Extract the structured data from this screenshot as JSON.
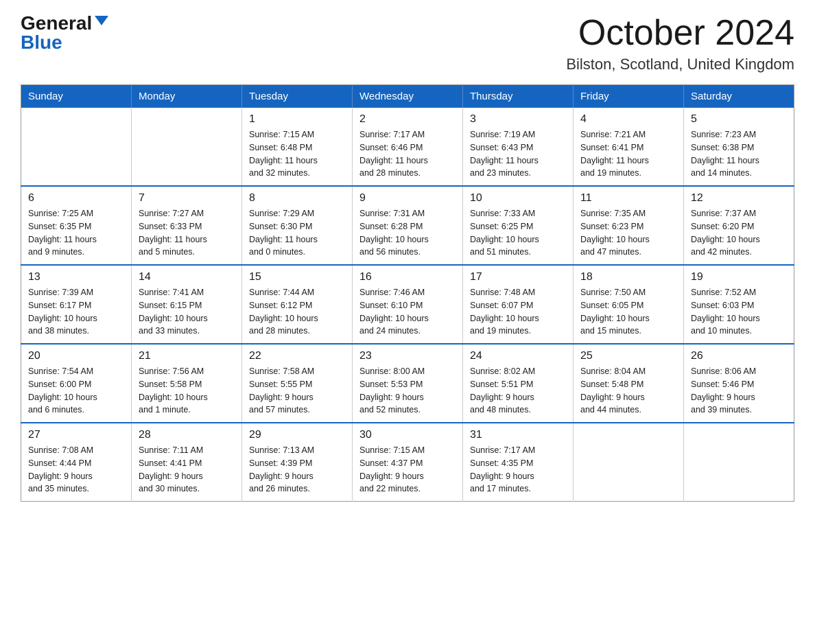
{
  "header": {
    "logo_general": "General",
    "logo_blue": "Blue",
    "month_title": "October 2024",
    "location": "Bilston, Scotland, United Kingdom"
  },
  "days_of_week": [
    "Sunday",
    "Monday",
    "Tuesday",
    "Wednesday",
    "Thursday",
    "Friday",
    "Saturday"
  ],
  "weeks": [
    [
      {
        "day": "",
        "info": ""
      },
      {
        "day": "",
        "info": ""
      },
      {
        "day": "1",
        "info": "Sunrise: 7:15 AM\nSunset: 6:48 PM\nDaylight: 11 hours\nand 32 minutes."
      },
      {
        "day": "2",
        "info": "Sunrise: 7:17 AM\nSunset: 6:46 PM\nDaylight: 11 hours\nand 28 minutes."
      },
      {
        "day": "3",
        "info": "Sunrise: 7:19 AM\nSunset: 6:43 PM\nDaylight: 11 hours\nand 23 minutes."
      },
      {
        "day": "4",
        "info": "Sunrise: 7:21 AM\nSunset: 6:41 PM\nDaylight: 11 hours\nand 19 minutes."
      },
      {
        "day": "5",
        "info": "Sunrise: 7:23 AM\nSunset: 6:38 PM\nDaylight: 11 hours\nand 14 minutes."
      }
    ],
    [
      {
        "day": "6",
        "info": "Sunrise: 7:25 AM\nSunset: 6:35 PM\nDaylight: 11 hours\nand 9 minutes."
      },
      {
        "day": "7",
        "info": "Sunrise: 7:27 AM\nSunset: 6:33 PM\nDaylight: 11 hours\nand 5 minutes."
      },
      {
        "day": "8",
        "info": "Sunrise: 7:29 AM\nSunset: 6:30 PM\nDaylight: 11 hours\nand 0 minutes."
      },
      {
        "day": "9",
        "info": "Sunrise: 7:31 AM\nSunset: 6:28 PM\nDaylight: 10 hours\nand 56 minutes."
      },
      {
        "day": "10",
        "info": "Sunrise: 7:33 AM\nSunset: 6:25 PM\nDaylight: 10 hours\nand 51 minutes."
      },
      {
        "day": "11",
        "info": "Sunrise: 7:35 AM\nSunset: 6:23 PM\nDaylight: 10 hours\nand 47 minutes."
      },
      {
        "day": "12",
        "info": "Sunrise: 7:37 AM\nSunset: 6:20 PM\nDaylight: 10 hours\nand 42 minutes."
      }
    ],
    [
      {
        "day": "13",
        "info": "Sunrise: 7:39 AM\nSunset: 6:17 PM\nDaylight: 10 hours\nand 38 minutes."
      },
      {
        "day": "14",
        "info": "Sunrise: 7:41 AM\nSunset: 6:15 PM\nDaylight: 10 hours\nand 33 minutes."
      },
      {
        "day": "15",
        "info": "Sunrise: 7:44 AM\nSunset: 6:12 PM\nDaylight: 10 hours\nand 28 minutes."
      },
      {
        "day": "16",
        "info": "Sunrise: 7:46 AM\nSunset: 6:10 PM\nDaylight: 10 hours\nand 24 minutes."
      },
      {
        "day": "17",
        "info": "Sunrise: 7:48 AM\nSunset: 6:07 PM\nDaylight: 10 hours\nand 19 minutes."
      },
      {
        "day": "18",
        "info": "Sunrise: 7:50 AM\nSunset: 6:05 PM\nDaylight: 10 hours\nand 15 minutes."
      },
      {
        "day": "19",
        "info": "Sunrise: 7:52 AM\nSunset: 6:03 PM\nDaylight: 10 hours\nand 10 minutes."
      }
    ],
    [
      {
        "day": "20",
        "info": "Sunrise: 7:54 AM\nSunset: 6:00 PM\nDaylight: 10 hours\nand 6 minutes."
      },
      {
        "day": "21",
        "info": "Sunrise: 7:56 AM\nSunset: 5:58 PM\nDaylight: 10 hours\nand 1 minute."
      },
      {
        "day": "22",
        "info": "Sunrise: 7:58 AM\nSunset: 5:55 PM\nDaylight: 9 hours\nand 57 minutes."
      },
      {
        "day": "23",
        "info": "Sunrise: 8:00 AM\nSunset: 5:53 PM\nDaylight: 9 hours\nand 52 minutes."
      },
      {
        "day": "24",
        "info": "Sunrise: 8:02 AM\nSunset: 5:51 PM\nDaylight: 9 hours\nand 48 minutes."
      },
      {
        "day": "25",
        "info": "Sunrise: 8:04 AM\nSunset: 5:48 PM\nDaylight: 9 hours\nand 44 minutes."
      },
      {
        "day": "26",
        "info": "Sunrise: 8:06 AM\nSunset: 5:46 PM\nDaylight: 9 hours\nand 39 minutes."
      }
    ],
    [
      {
        "day": "27",
        "info": "Sunrise: 7:08 AM\nSunset: 4:44 PM\nDaylight: 9 hours\nand 35 minutes."
      },
      {
        "day": "28",
        "info": "Sunrise: 7:11 AM\nSunset: 4:41 PM\nDaylight: 9 hours\nand 30 minutes."
      },
      {
        "day": "29",
        "info": "Sunrise: 7:13 AM\nSunset: 4:39 PM\nDaylight: 9 hours\nand 26 minutes."
      },
      {
        "day": "30",
        "info": "Sunrise: 7:15 AM\nSunset: 4:37 PM\nDaylight: 9 hours\nand 22 minutes."
      },
      {
        "day": "31",
        "info": "Sunrise: 7:17 AM\nSunset: 4:35 PM\nDaylight: 9 hours\nand 17 minutes."
      },
      {
        "day": "",
        "info": ""
      },
      {
        "day": "",
        "info": ""
      }
    ]
  ]
}
